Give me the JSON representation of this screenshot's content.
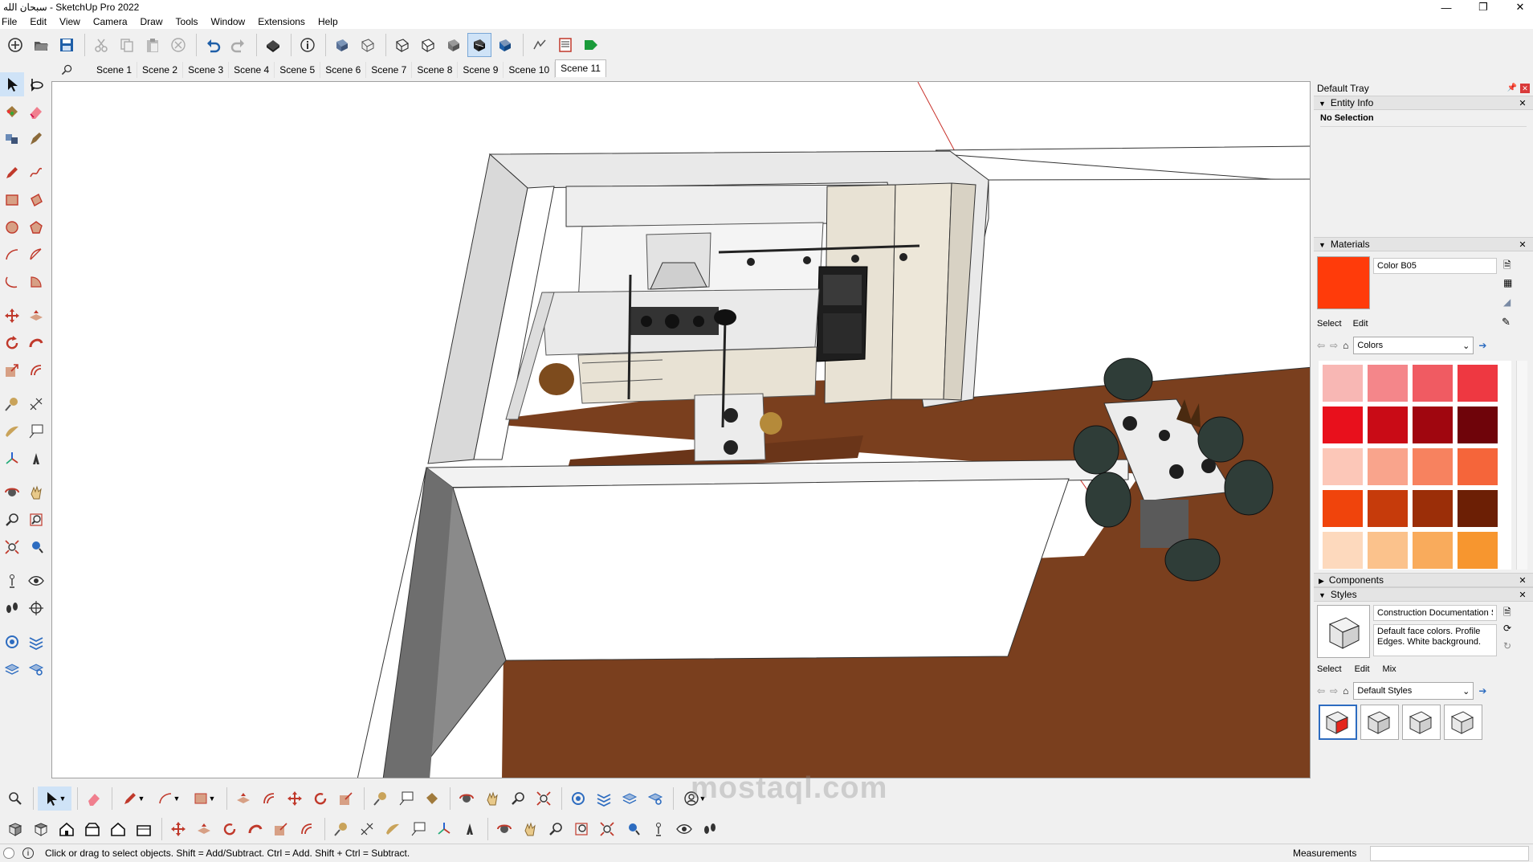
{
  "window": {
    "title": "سبحان الله - SketchUp Pro 2022",
    "controls": {
      "minimize": "—",
      "maximize": "❐",
      "close": "✕"
    }
  },
  "menu": [
    "File",
    "Edit",
    "View",
    "Camera",
    "Draw",
    "Tools",
    "Window",
    "Extensions",
    "Help"
  ],
  "scenes": {
    "tabs": [
      "Scene 1",
      "Scene 2",
      "Scene 3",
      "Scene 4",
      "Scene 5",
      "Scene 6",
      "Scene 7",
      "Scene 8",
      "Scene 9",
      "Scene 10",
      "Scene 11"
    ],
    "active": "Scene 11"
  },
  "tray": {
    "title": "Default Tray",
    "entity_info": {
      "label": "Entity Info",
      "selection": "No Selection"
    },
    "materials": {
      "label": "Materials",
      "current_name": "Color B05",
      "current_color": "#ff3b0a",
      "tabs": [
        "Select",
        "Edit"
      ],
      "library": "Colors",
      "swatches": [
        "#f8b7b4",
        "#f4868a",
        "#f05b62",
        "#ee3841",
        "#e8101c",
        "#c90b16",
        "#a0060f",
        "#6f040a",
        "#fcc7b8",
        "#f9a48c",
        "#f7825f",
        "#f5653a",
        "#f0440c",
        "#c63b0b",
        "#9b2e08",
        "#6c1f05",
        "#fdd9bd",
        "#fbc28c",
        "#f9ab5c",
        "#f7962f",
        "#f58220",
        "#d4680f",
        "#a65008",
        "#7a3a05"
      ]
    },
    "components": {
      "label": "Components"
    },
    "styles": {
      "label": "Styles",
      "name": "Construction Documentation St",
      "description": "Default face colors. Profile Edges. White background.",
      "tabs": [
        "Select",
        "Edit",
        "Mix"
      ],
      "library": "Default Styles"
    }
  },
  "status": {
    "hint": "Click or drag to select objects. Shift = Add/Subtract. Ctrl = Add. Shift + Ctrl = Subtract.",
    "measurements_label": "Measurements",
    "measurements_value": ""
  },
  "watermark": "mostaql.com",
  "colors": {
    "axis_red": "#c8312a",
    "floor": "#7a3f1e",
    "cabinet": "#e8e2d4",
    "wall": "#ffffff"
  }
}
